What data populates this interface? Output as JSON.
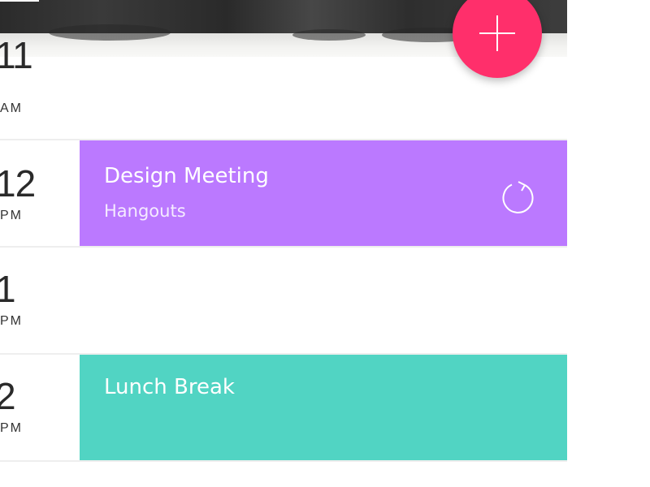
{
  "colors": {
    "fab": "#FF2F6B",
    "design_meeting": "#BB79FF",
    "lunch_break": "#51D4C3",
    "text_dark": "#2A2A2A",
    "separator": "#EEEEEE"
  },
  "fab": {
    "icon": "plus-icon"
  },
  "timeline": {
    "slots": [
      {
        "hour": "11",
        "period": "AM"
      },
      {
        "hour": "12",
        "period": "PM"
      },
      {
        "hour": "1",
        "period": "PM"
      },
      {
        "hour": "2",
        "period": "PM"
      }
    ]
  },
  "events": {
    "design_meeting": {
      "title": "Design Meeting",
      "location": "Hangouts",
      "icon": "repeat-icon"
    },
    "lunch_break": {
      "title": "Lunch Break"
    }
  }
}
